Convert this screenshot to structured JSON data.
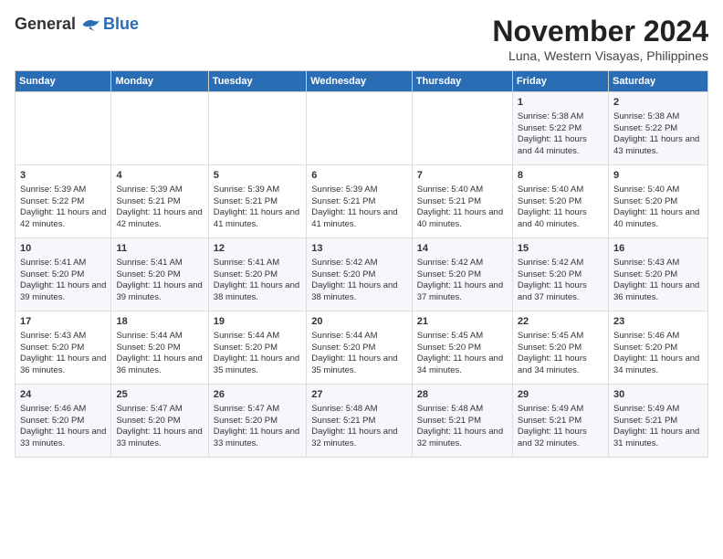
{
  "logo": {
    "general": "General",
    "blue": "Blue"
  },
  "title": "November 2024",
  "subtitle": "Luna, Western Visayas, Philippines",
  "days_of_week": [
    "Sunday",
    "Monday",
    "Tuesday",
    "Wednesday",
    "Thursday",
    "Friday",
    "Saturday"
  ],
  "weeks": [
    [
      {
        "day": "",
        "info": ""
      },
      {
        "day": "",
        "info": ""
      },
      {
        "day": "",
        "info": ""
      },
      {
        "day": "",
        "info": ""
      },
      {
        "day": "",
        "info": ""
      },
      {
        "day": "1",
        "info": "Sunrise: 5:38 AM\nSunset: 5:22 PM\nDaylight: 11 hours and 44 minutes."
      },
      {
        "day": "2",
        "info": "Sunrise: 5:38 AM\nSunset: 5:22 PM\nDaylight: 11 hours and 43 minutes."
      }
    ],
    [
      {
        "day": "3",
        "info": "Sunrise: 5:39 AM\nSunset: 5:22 PM\nDaylight: 11 hours and 42 minutes."
      },
      {
        "day": "4",
        "info": "Sunrise: 5:39 AM\nSunset: 5:21 PM\nDaylight: 11 hours and 42 minutes."
      },
      {
        "day": "5",
        "info": "Sunrise: 5:39 AM\nSunset: 5:21 PM\nDaylight: 11 hours and 41 minutes."
      },
      {
        "day": "6",
        "info": "Sunrise: 5:39 AM\nSunset: 5:21 PM\nDaylight: 11 hours and 41 minutes."
      },
      {
        "day": "7",
        "info": "Sunrise: 5:40 AM\nSunset: 5:21 PM\nDaylight: 11 hours and 40 minutes."
      },
      {
        "day": "8",
        "info": "Sunrise: 5:40 AM\nSunset: 5:20 PM\nDaylight: 11 hours and 40 minutes."
      },
      {
        "day": "9",
        "info": "Sunrise: 5:40 AM\nSunset: 5:20 PM\nDaylight: 11 hours and 40 minutes."
      }
    ],
    [
      {
        "day": "10",
        "info": "Sunrise: 5:41 AM\nSunset: 5:20 PM\nDaylight: 11 hours and 39 minutes."
      },
      {
        "day": "11",
        "info": "Sunrise: 5:41 AM\nSunset: 5:20 PM\nDaylight: 11 hours and 39 minutes."
      },
      {
        "day": "12",
        "info": "Sunrise: 5:41 AM\nSunset: 5:20 PM\nDaylight: 11 hours and 38 minutes."
      },
      {
        "day": "13",
        "info": "Sunrise: 5:42 AM\nSunset: 5:20 PM\nDaylight: 11 hours and 38 minutes."
      },
      {
        "day": "14",
        "info": "Sunrise: 5:42 AM\nSunset: 5:20 PM\nDaylight: 11 hours and 37 minutes."
      },
      {
        "day": "15",
        "info": "Sunrise: 5:42 AM\nSunset: 5:20 PM\nDaylight: 11 hours and 37 minutes."
      },
      {
        "day": "16",
        "info": "Sunrise: 5:43 AM\nSunset: 5:20 PM\nDaylight: 11 hours and 36 minutes."
      }
    ],
    [
      {
        "day": "17",
        "info": "Sunrise: 5:43 AM\nSunset: 5:20 PM\nDaylight: 11 hours and 36 minutes."
      },
      {
        "day": "18",
        "info": "Sunrise: 5:44 AM\nSunset: 5:20 PM\nDaylight: 11 hours and 36 minutes."
      },
      {
        "day": "19",
        "info": "Sunrise: 5:44 AM\nSunset: 5:20 PM\nDaylight: 11 hours and 35 minutes."
      },
      {
        "day": "20",
        "info": "Sunrise: 5:44 AM\nSunset: 5:20 PM\nDaylight: 11 hours and 35 minutes."
      },
      {
        "day": "21",
        "info": "Sunrise: 5:45 AM\nSunset: 5:20 PM\nDaylight: 11 hours and 34 minutes."
      },
      {
        "day": "22",
        "info": "Sunrise: 5:45 AM\nSunset: 5:20 PM\nDaylight: 11 hours and 34 minutes."
      },
      {
        "day": "23",
        "info": "Sunrise: 5:46 AM\nSunset: 5:20 PM\nDaylight: 11 hours and 34 minutes."
      }
    ],
    [
      {
        "day": "24",
        "info": "Sunrise: 5:46 AM\nSunset: 5:20 PM\nDaylight: 11 hours and 33 minutes."
      },
      {
        "day": "25",
        "info": "Sunrise: 5:47 AM\nSunset: 5:20 PM\nDaylight: 11 hours and 33 minutes."
      },
      {
        "day": "26",
        "info": "Sunrise: 5:47 AM\nSunset: 5:20 PM\nDaylight: 11 hours and 33 minutes."
      },
      {
        "day": "27",
        "info": "Sunrise: 5:48 AM\nSunset: 5:21 PM\nDaylight: 11 hours and 32 minutes."
      },
      {
        "day": "28",
        "info": "Sunrise: 5:48 AM\nSunset: 5:21 PM\nDaylight: 11 hours and 32 minutes."
      },
      {
        "day": "29",
        "info": "Sunrise: 5:49 AM\nSunset: 5:21 PM\nDaylight: 11 hours and 32 minutes."
      },
      {
        "day": "30",
        "info": "Sunrise: 5:49 AM\nSunset: 5:21 PM\nDaylight: 11 hours and 31 minutes."
      }
    ]
  ]
}
